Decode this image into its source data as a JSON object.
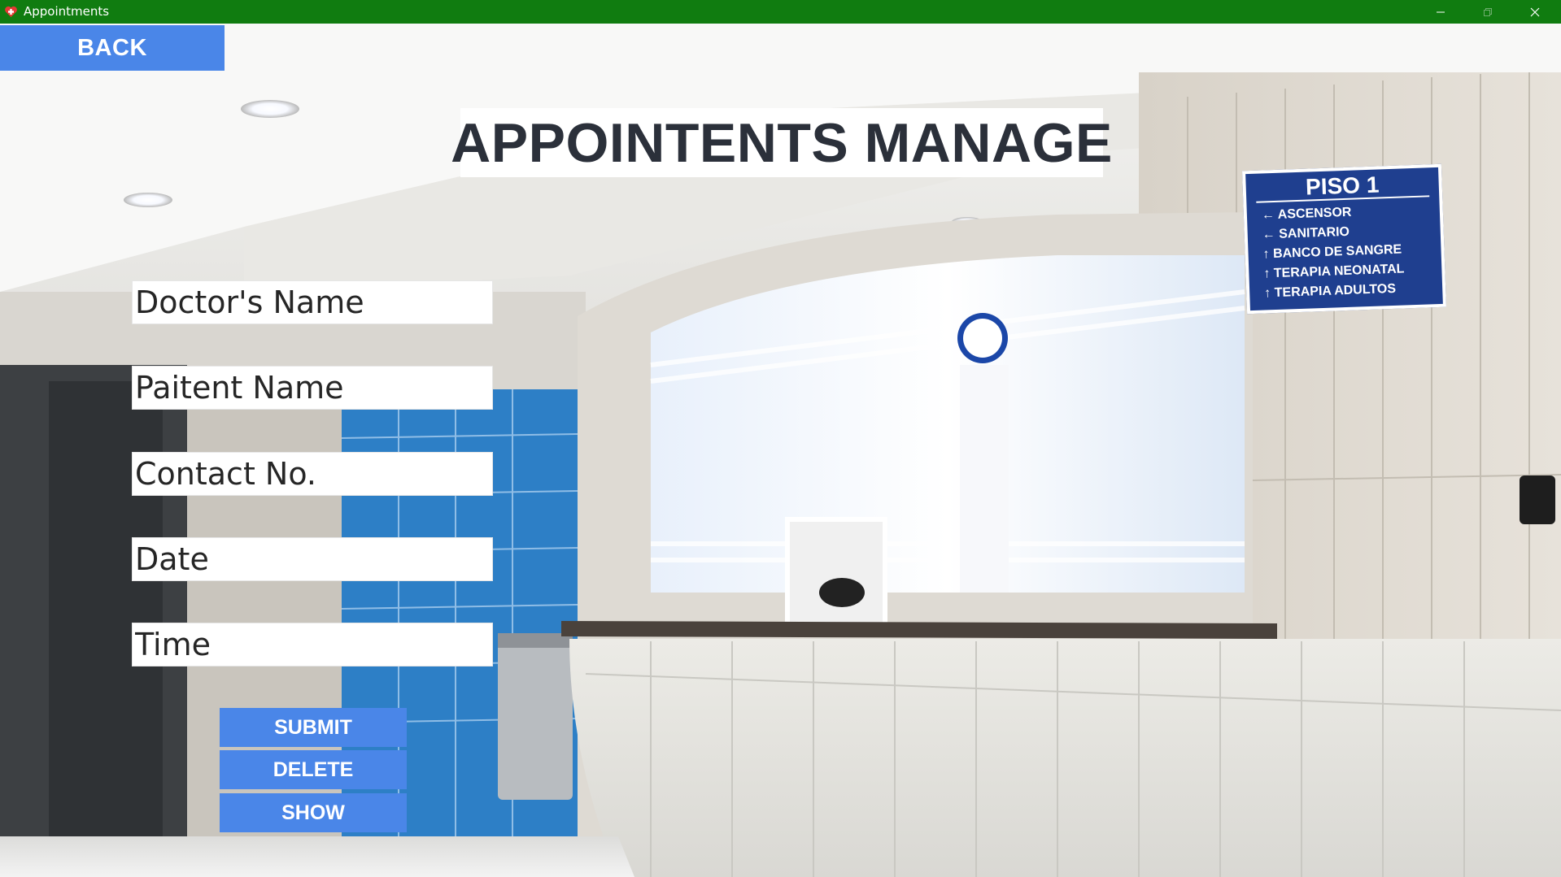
{
  "window": {
    "title": "Appointments",
    "accent": "#107c10",
    "controls": [
      "minimize-icon",
      "maximize-icon",
      "close-icon"
    ]
  },
  "back_button": {
    "label": "BACK"
  },
  "page_title": "APPOINTENTS MANAGE",
  "form": {
    "doctor_name": {
      "placeholder": "Doctor's Name",
      "value": ""
    },
    "patient_name": {
      "placeholder": "Paitent Name",
      "value": ""
    },
    "contact_no": {
      "placeholder": "Contact No.",
      "value": ""
    },
    "date": {
      "placeholder": "Date",
      "value": ""
    },
    "time": {
      "placeholder": "Time",
      "value": ""
    }
  },
  "actions": {
    "submit_label": "SUBMIT",
    "delete_label": "DELETE",
    "show_label": "SHOW"
  },
  "background_sign": {
    "title": "PISO 1",
    "items": [
      "ASCENSOR",
      "SANITARIO",
      "BANCO DE SANGRE",
      "TERAPIA NEONATAL",
      "TERAPIA ADULTOS"
    ]
  },
  "colors": {
    "button_blue": "#4a86e8",
    "title_text": "#2b303a",
    "sign_blue": "#1f3f8f"
  }
}
